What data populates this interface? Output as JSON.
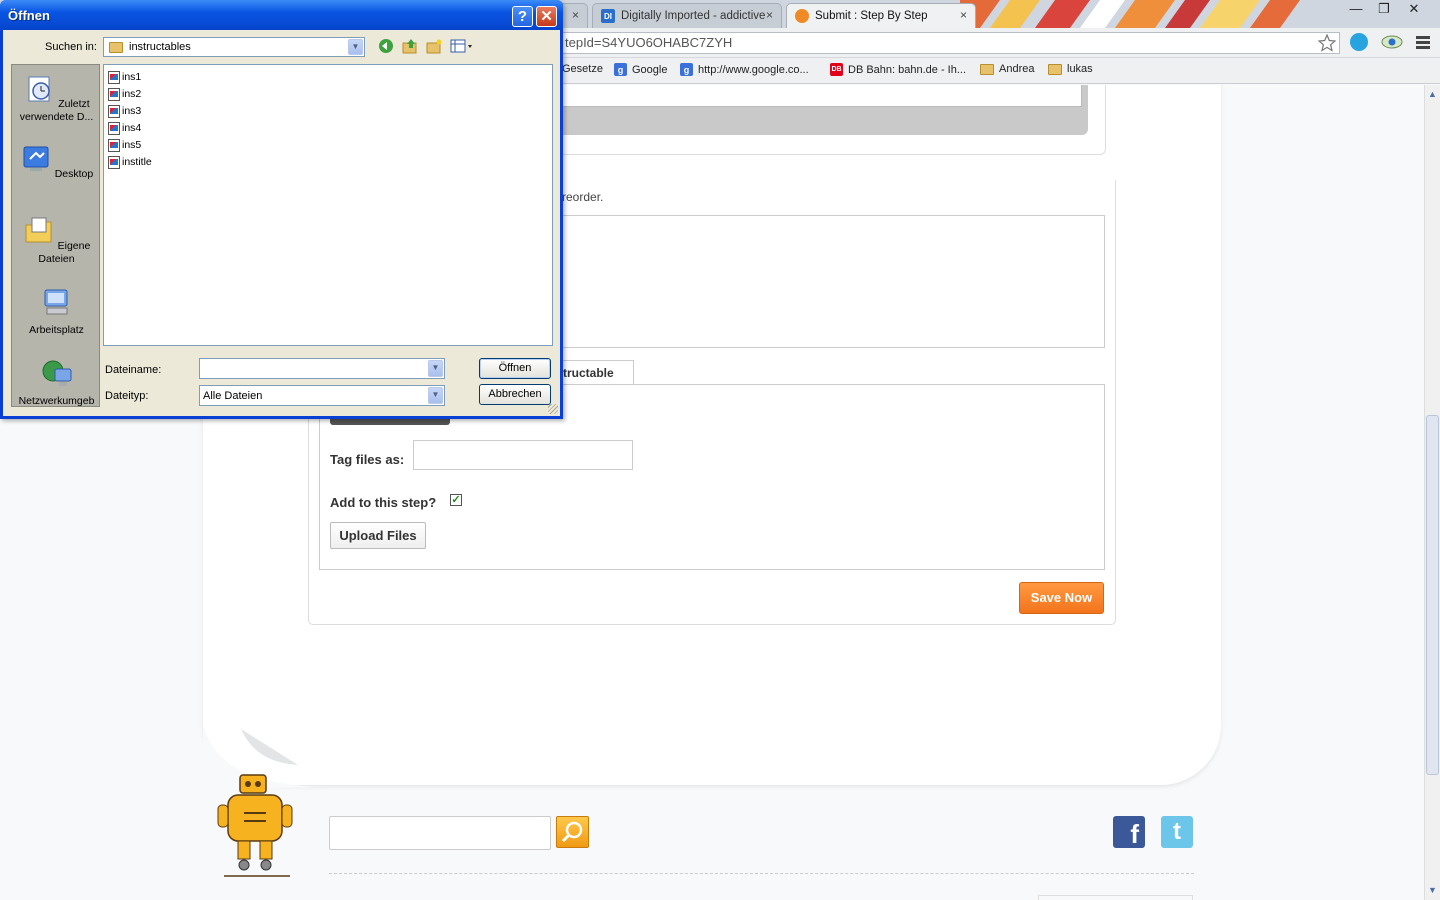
{
  "browser": {
    "tabs": [
      {
        "label": ""
      },
      {
        "label": "Digitally Imported - addictive"
      },
      {
        "label": "Submit : Step By Step"
      }
    ],
    "tab_close_glyph": "×",
    "window_controls": {
      "minimize": "—",
      "restore": "❐",
      "close": "✕"
    },
    "address": "tepId=S4YUO6OHABC7ZYH",
    "bookmarks": [
      {
        "label": "Gesetze",
        "icon": "folder-icon"
      },
      {
        "label": "Google",
        "icon": "google-icon"
      },
      {
        "label": "http://www.google.co...",
        "icon": "google-icon"
      },
      {
        "label": "DB Bahn: bahn.de - Ih...",
        "icon": "db-icon"
      },
      {
        "label": "Andrea",
        "icon": "folder-icon"
      },
      {
        "label": "lukas",
        "icon": "folder-icon"
      }
    ]
  },
  "page": {
    "reorder_text": "reorder.",
    "tab_label": "tructable",
    "tag_label": "Tag files as:",
    "add_step_label": "Add to this step?",
    "add_step_checked": true,
    "upload_button": "Upload Files",
    "save_button": "Save Now",
    "search_placeholder": ""
  },
  "dialog": {
    "title": "Öffnen",
    "help_glyph": "?",
    "close_glyph": "✕",
    "look_in_label": "Suchen in:",
    "look_in_value": "instructables",
    "places": [
      {
        "label": "Zuletzt verwendete D...",
        "icon": "recent-documents-icon"
      },
      {
        "label": "Desktop",
        "icon": "desktop-icon"
      },
      {
        "label": "Eigene Dateien",
        "icon": "my-documents-icon"
      },
      {
        "label": "Arbeitsplatz",
        "icon": "my-computer-icon"
      },
      {
        "label": "Netzwerkumgeb",
        "icon": "network-icon"
      }
    ],
    "files": [
      "ins1",
      "ins2",
      "ins3",
      "ins4",
      "ins5",
      "institle"
    ],
    "filename_label": "Dateiname:",
    "filename_value": "",
    "filetype_label": "Dateityp:",
    "filetype_value": "Alle Dateien",
    "open_button": "Öffnen",
    "cancel_button": "Abbrechen"
  },
  "colors": {
    "accent_orange": "#f2741c",
    "xp_title_blue": "#0a55e3",
    "facebook": "#3b5998",
    "twitter": "#6cc6ea"
  }
}
